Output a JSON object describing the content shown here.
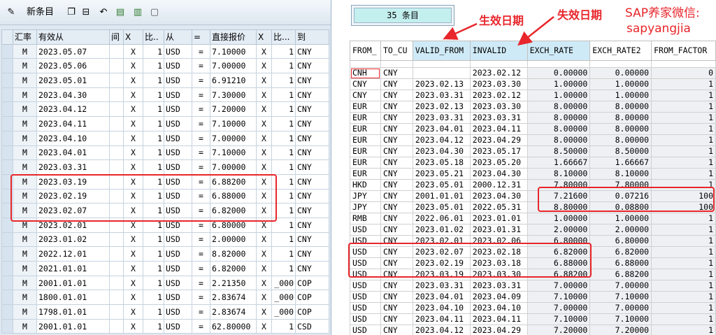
{
  "left": {
    "toolbar": {
      "new_entries_label": "新条目",
      "icons": [
        "pencil-glasses-icon",
        "copy-icon",
        "delete-icon",
        "undo-icon",
        "select-all-icon",
        "select-block-icon",
        "deselect-all-icon"
      ]
    },
    "columns": [
      "汇率",
      "有效从",
      "间",
      "X",
      "比..",
      "从",
      "=",
      "直接报价",
      "X",
      "比...",
      "到"
    ],
    "rows": [
      [
        "M",
        "2023.05.07",
        "",
        "X",
        "1",
        "USD",
        "=",
        "7.10000",
        "X",
        "1",
        "CNY"
      ],
      [
        "M",
        "2023.05.06",
        "",
        "X",
        "1",
        "USD",
        "=",
        "7.00000",
        "X",
        "1",
        "CNY"
      ],
      [
        "M",
        "2023.05.01",
        "",
        "X",
        "1",
        "USD",
        "=",
        "6.91210",
        "X",
        "1",
        "CNY"
      ],
      [
        "M",
        "2023.04.30",
        "",
        "X",
        "1",
        "USD",
        "=",
        "7.30000",
        "X",
        "1",
        "CNY"
      ],
      [
        "M",
        "2023.04.12",
        "",
        "X",
        "1",
        "USD",
        "=",
        "7.20000",
        "X",
        "1",
        "CNY"
      ],
      [
        "M",
        "2023.04.11",
        "",
        "X",
        "1",
        "USD",
        "=",
        "7.10000",
        "X",
        "1",
        "CNY"
      ],
      [
        "M",
        "2023.04.10",
        "",
        "X",
        "1",
        "USD",
        "=",
        "7.00000",
        "X",
        "1",
        "CNY"
      ],
      [
        "M",
        "2023.04.01",
        "",
        "X",
        "1",
        "USD",
        "=",
        "7.10000",
        "X",
        "1",
        "CNY"
      ],
      [
        "M",
        "2023.03.31",
        "",
        "X",
        "1",
        "USD",
        "=",
        "7.00000",
        "X",
        "1",
        "CNY"
      ],
      [
        "M",
        "2023.03.19",
        "",
        "X",
        "1",
        "USD",
        "=",
        "6.88200",
        "X",
        "1",
        "CNY"
      ],
      [
        "M",
        "2023.02.19",
        "",
        "X",
        "1",
        "USD",
        "=",
        "6.88000",
        "X",
        "1",
        "CNY"
      ],
      [
        "M",
        "2023.02.07",
        "",
        "X",
        "1",
        "USD",
        "=",
        "6.82000",
        "X",
        "1",
        "CNY"
      ],
      [
        "M",
        "2023.02.01",
        "",
        "X",
        "1",
        "USD",
        "=",
        "6.80000",
        "X",
        "1",
        "CNY"
      ],
      [
        "M",
        "2023.01.02",
        "",
        "X",
        "1",
        "USD",
        "=",
        "2.00000",
        "X",
        "1",
        "CNY"
      ],
      [
        "M",
        "2022.12.01",
        "",
        "X",
        "1",
        "USD",
        "=",
        "8.82000",
        "X",
        "1",
        "CNY"
      ],
      [
        "M",
        "2021.01.01",
        "",
        "X",
        "1",
        "USD",
        "=",
        "6.82000",
        "X",
        "1",
        "CNY"
      ],
      [
        "M",
        "2001.01.01",
        "",
        "X",
        "1",
        "USD",
        "=",
        "2.21350",
        "X",
        "_000",
        "COP"
      ],
      [
        "M",
        "1800.01.01",
        "",
        "X",
        "1",
        "USD",
        "=",
        "2.83674",
        "X",
        "_000",
        "COP"
      ],
      [
        "M",
        "1798.01.01",
        "",
        "X",
        "1",
        "USD",
        "=",
        "2.83674",
        "X",
        "_000",
        "COP"
      ],
      [
        "M",
        "2001.01.01",
        "",
        "X",
        "1",
        "USD",
        "=",
        "62.80000",
        "X",
        "1",
        "CSD"
      ]
    ]
  },
  "right": {
    "entry_count": "35 条目",
    "annotations": {
      "valid_from": "生效日期",
      "invalid": "失效日期",
      "wechat_line1": "SAP养家微信:",
      "wechat_line2": "sapyangjia"
    },
    "columns": [
      "FROM_",
      "TO_CU",
      "VALID_FROM",
      "INVALID",
      "EXCH_RATE",
      "EXCH_RATE2",
      "FROM_FACTOR"
    ],
    "rows": [
      [
        "CNH",
        "CNY",
        "",
        "2023.02.12",
        "0.00000",
        "0.00000",
        "0"
      ],
      [
        "CNY",
        "CNY",
        "2023.02.13",
        "2023.03.30",
        "1.00000",
        "1.00000",
        "1"
      ],
      [
        "CNY",
        "CNY",
        "2023.03.31",
        "2023.02.12",
        "1.00000",
        "1.00000",
        "1"
      ],
      [
        "EUR",
        "CNY",
        "2023.02.13",
        "2023.03.30",
        "8.00000",
        "8.00000",
        "1"
      ],
      [
        "EUR",
        "CNY",
        "2023.03.31",
        "2023.03.31",
        "8.00000",
        "8.00000",
        "1"
      ],
      [
        "EUR",
        "CNY",
        "2023.04.01",
        "2023.04.11",
        "8.00000",
        "8.00000",
        "1"
      ],
      [
        "EUR",
        "CNY",
        "2023.04.12",
        "2023.04.29",
        "8.00000",
        "8.00000",
        "1"
      ],
      [
        "EUR",
        "CNY",
        "2023.04.30",
        "2023.05.17",
        "8.50000",
        "8.50000",
        "1"
      ],
      [
        "EUR",
        "CNY",
        "2023.05.18",
        "2023.05.20",
        "1.66667",
        "1.66667",
        "1"
      ],
      [
        "EUR",
        "CNY",
        "2023.05.21",
        "2023.04.30",
        "8.10000",
        "8.10000",
        "1"
      ],
      [
        "HKD",
        "CNY",
        "2023.05.01",
        "2000.12.31",
        "7.80000",
        "7.80000",
        "1"
      ],
      [
        "JPY",
        "CNY",
        "2001.01.01",
        "2023.04.30",
        "7.21600",
        "0.07216",
        "100"
      ],
      [
        "JPY",
        "CNY",
        "2023.05.01",
        "2022.05.31",
        "8.80000",
        "0.08800",
        "100"
      ],
      [
        "RMB",
        "CNY",
        "2022.06.01",
        "2023.01.01",
        "1.00000",
        "1.00000",
        "1"
      ],
      [
        "USD",
        "CNY",
        "2023.01.02",
        "2023.01.31",
        "2.00000",
        "2.00000",
        "1"
      ],
      [
        "USD",
        "CNY",
        "2023.02.01",
        "2023.02.06",
        "6.80000",
        "6.80000",
        "1"
      ],
      [
        "USD",
        "CNY",
        "2023.02.07",
        "2023.02.18",
        "6.82000",
        "6.82000",
        "1"
      ],
      [
        "USD",
        "CNY",
        "2023.02.19",
        "2023.03.18",
        "6.88000",
        "6.88000",
        "1"
      ],
      [
        "USD",
        "CNY",
        "2023.03.19",
        "2023.03.30",
        "6.88200",
        "6.88200",
        "1"
      ],
      [
        "USD",
        "CNY",
        "2023.03.31",
        "2023.03.31",
        "7.00000",
        "7.00000",
        "1"
      ],
      [
        "USD",
        "CNY",
        "2023.04.01",
        "2023.04.09",
        "7.10000",
        "7.10000",
        "1"
      ],
      [
        "USD",
        "CNY",
        "2023.04.10",
        "2023.04.10",
        "7.00000",
        "7.00000",
        "1"
      ],
      [
        "USD",
        "CNY",
        "2023.04.11",
        "2023.04.11",
        "7.10000",
        "7.10000",
        "1"
      ],
      [
        "USD",
        "CNY",
        "2023.04.12",
        "2023.04.29",
        "7.20000",
        "7.20000",
        "1"
      ]
    ]
  },
  "colors": {
    "highlight_red": "#e8262b",
    "header_cyan": "#cfeaf7",
    "count_cyan": "#c4efef"
  }
}
